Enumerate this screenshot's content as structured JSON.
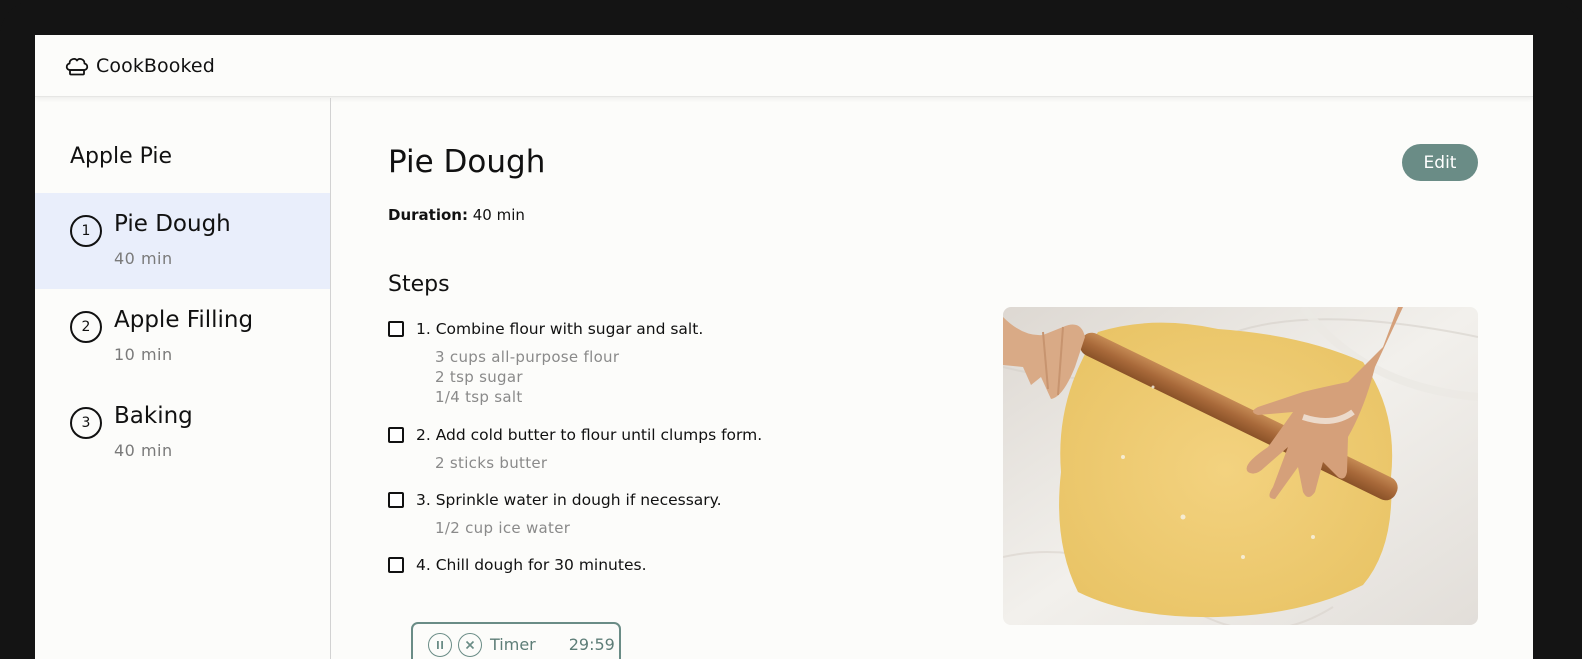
{
  "app": {
    "name": "CookBooked",
    "logo_icon": "chef-hat-icon"
  },
  "recipe": {
    "title": "Apple Pie"
  },
  "sidebar": {
    "stages": [
      {
        "number": "1",
        "name": "Pie Dough",
        "duration": "40 min",
        "active": true
      },
      {
        "number": "2",
        "name": "Apple Filling",
        "duration": "10 min",
        "active": false
      },
      {
        "number": "3",
        "name": "Baking",
        "duration": "40 min",
        "active": false
      }
    ]
  },
  "main": {
    "title": "Pie Dough",
    "edit_label": "Edit",
    "duration_label": "Duration:",
    "duration_value": "40 min",
    "steps_heading": "Steps",
    "steps": [
      {
        "text": "1. Combine flour with sugar and salt.",
        "ingredients": [
          "3 cups all-purpose flour",
          "2 tsp sugar",
          "1/4 tsp salt"
        ],
        "checked": false
      },
      {
        "text": "2. Add cold butter to flour until clumps form.",
        "ingredients": [
          "2 sticks butter"
        ],
        "checked": false
      },
      {
        "text": "3. Sprinkle water in dough if necessary.",
        "ingredients": [
          "1/2 cup ice water"
        ],
        "checked": false
      },
      {
        "text": "4. Chill dough for 30 minutes.",
        "ingredients": [],
        "checked": false
      }
    ],
    "timer": {
      "label": "Timer",
      "time": "29:59",
      "pause_icon": "pause-icon",
      "close_icon": "close-icon"
    }
  },
  "colors": {
    "accent": "#6a8c86",
    "active_stage_bg": "#e9eefb",
    "muted_text": "#8a8a8a"
  }
}
